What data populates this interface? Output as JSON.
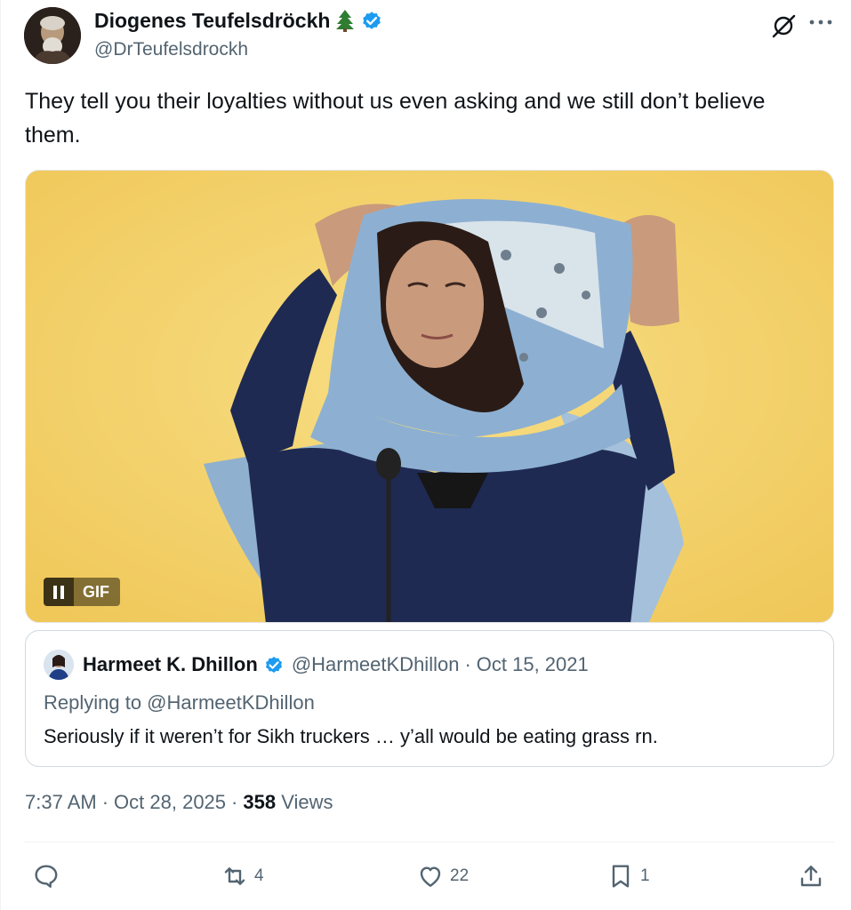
{
  "author": {
    "name": "Diogenes Teufelsdröckh",
    "handle": "@DrTeufelsdrockh"
  },
  "tweet": {
    "text": "They tell you their loyalties without us even asking and we still don’t believe them."
  },
  "media": {
    "badge_label": "GIF"
  },
  "quoted": {
    "name": "Harmeet K. Dhillon",
    "handle": "@HarmeetKDhillon",
    "separator": "·",
    "date": "Oct 15, 2021",
    "replying_to": "Replying to @HarmeetKDhillon",
    "text": "Seriously if it weren’t for Sikh truckers … y’all would be eating grass rn."
  },
  "meta": {
    "time": "7:37 AM",
    "dot1": "·",
    "date": "Oct 28, 2025",
    "dot2": "·",
    "views_count": "358",
    "views_label": "Views"
  },
  "actions": {
    "reply_icon": "reply-icon",
    "retweet_icon": "retweet-icon",
    "retweet_count": "4",
    "like_icon": "heart-icon",
    "like_count": "22",
    "bookmark_icon": "bookmark-icon",
    "bookmark_count": "1",
    "share_icon": "share-icon"
  },
  "colors": {
    "verified": "#1d9bf0",
    "secondary_text": "#536471",
    "primary_text": "#0f1419",
    "gif_background": "#f3d46b"
  }
}
